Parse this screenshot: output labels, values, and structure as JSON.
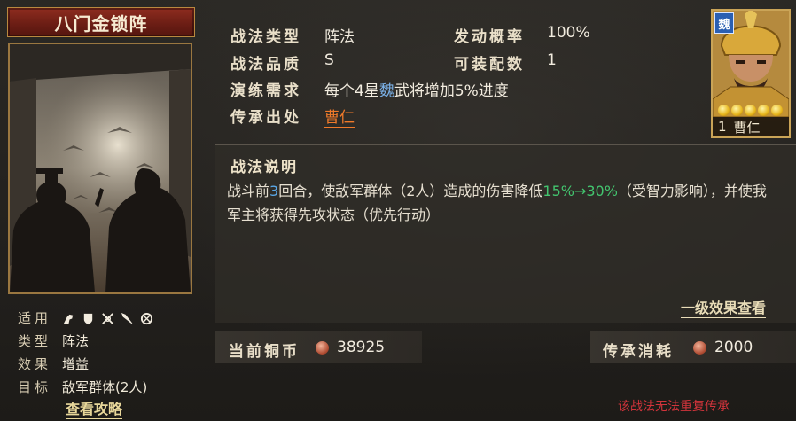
{
  "skill": {
    "name": "八门金锁阵",
    "attributes": {
      "type_label": "战法类型",
      "type_value": "阵法",
      "rate_label": "发动概率",
      "rate_value": "100%",
      "quality_label": "战法品质",
      "quality_value": "S",
      "equip_label": "可装配数",
      "equip_value": "1",
      "train_label": "演练需求",
      "train_pre": "每个4星",
      "train_faction": "魏",
      "train_post": "武将增加5%进度",
      "inherit_label": "传承出处",
      "inherit_value": "曹仁"
    },
    "description": {
      "title": "战法说明",
      "t1": "战斗前",
      "n1": "3",
      "t2": "回合，使敌军群体（2人）造成的伤害降低",
      "range": "15%→30%",
      "t3": "（受智力影响），并使我军主将获得先攻状态（优先行动）"
    },
    "effect_link": "一级效果查看"
  },
  "card_info": {
    "apply_label": "适用",
    "class_label": "类型",
    "class_value": "阵法",
    "effect_label": "效果",
    "effect_value": "增益",
    "target_label": "目标",
    "target_value": "敌军群体(2人)",
    "guide_link": "查看攻略",
    "unit_icons": [
      "cavalry-icon",
      "shield-icon",
      "bow-icon",
      "spear-icon",
      "siege-icon"
    ]
  },
  "general": {
    "faction": "魏",
    "level": "1",
    "name": "曹仁",
    "stars": 5
  },
  "resources": {
    "copper_label": "当前铜币",
    "copper_value": "38925",
    "cost_label": "传承消耗",
    "cost_value": "2000"
  },
  "warning": "该战法无法重复传承",
  "colors": {
    "accent_orange": "#f07a2a",
    "green": "#43c56f",
    "warning_red": "#d1343b",
    "faction_blue": "#2b5fb2"
  }
}
